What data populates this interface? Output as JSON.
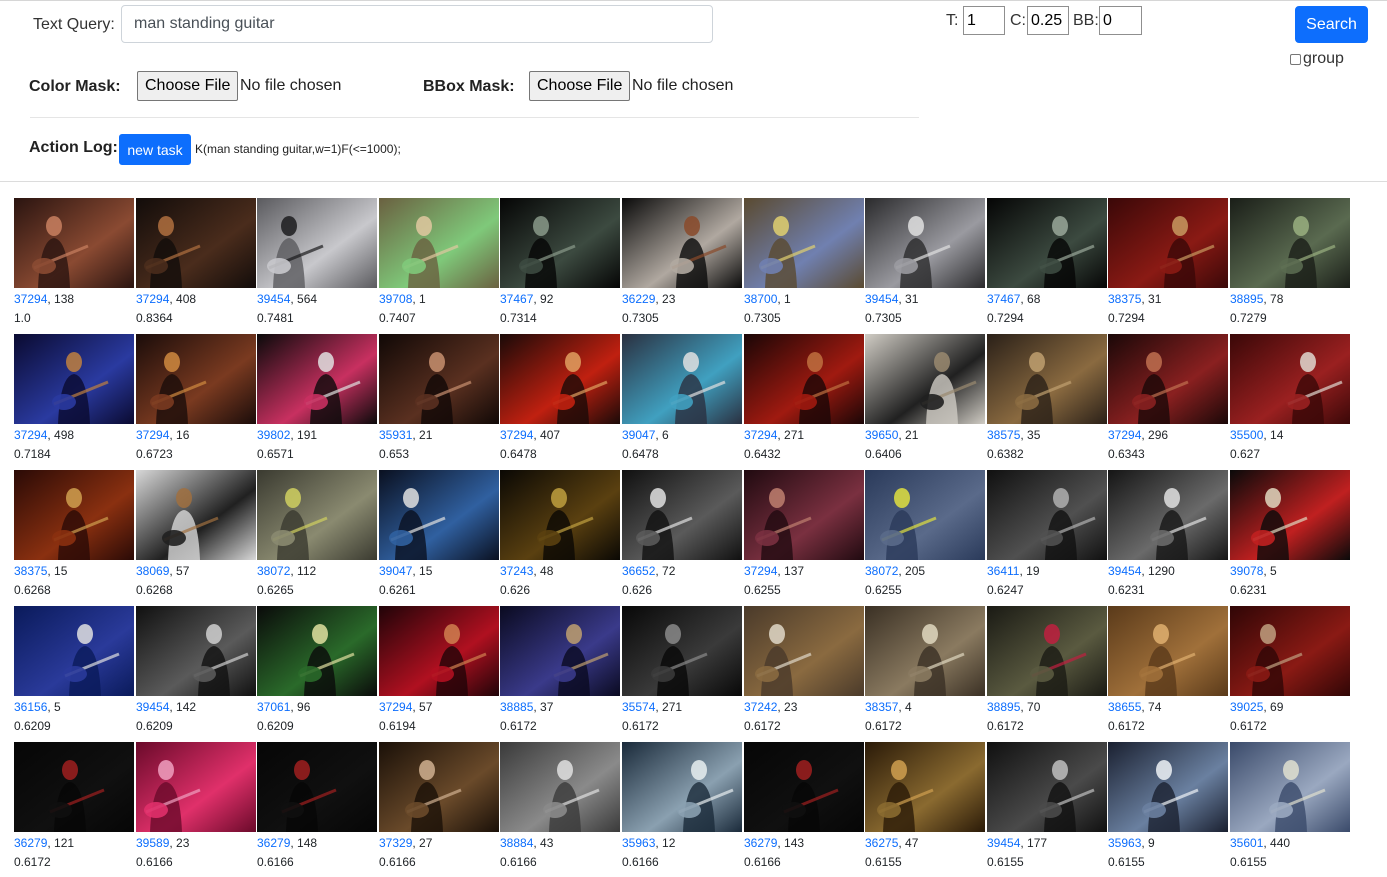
{
  "query": {
    "label": "Text Query:",
    "value": "man standing guitar"
  },
  "params": [
    {
      "label": "T:",
      "value": "1"
    },
    {
      "label": "C:",
      "value": "0.25"
    },
    {
      "label": "BB:",
      "value": "0"
    }
  ],
  "search_label": "Search",
  "group_label": "group",
  "masks": {
    "color_label": "Color Mask:",
    "bbox_label": "BBox Mask:",
    "choose_file": "Choose File",
    "no_file": "No file chosen"
  },
  "action_log": {
    "label": "Action Log:",
    "button": "new task",
    "text": "K(man standing guitar,w=1)F(<=1000);"
  },
  "colors": {
    "accent": "#0d6efd",
    "link": "#0d6efd"
  },
  "results": [
    {
      "video": "37294",
      "frame": "138",
      "score": "1.0",
      "palette": [
        "#2a1410",
        "#8a4a32",
        "#c98060"
      ]
    },
    {
      "video": "37294",
      "frame": "408",
      "score": "0.8364",
      "palette": [
        "#120c0a",
        "#4a2c1c",
        "#b07040"
      ]
    },
    {
      "video": "39454",
      "frame": "564",
      "score": "0.7481",
      "palette": [
        "#5a5a5e",
        "#c8c8cc",
        "#1c1c1e"
      ]
    },
    {
      "video": "39708",
      "frame": "1",
      "score": "0.7407",
      "palette": [
        "#6a6040",
        "#7fc97a",
        "#e0c8a0"
      ]
    },
    {
      "video": "37467",
      "frame": "92",
      "score": "0.7314",
      "palette": [
        "#050505",
        "#3c4a40",
        "#8a9a8a"
      ]
    },
    {
      "video": "36229",
      "frame": "23",
      "score": "0.7305",
      "palette": [
        "#0a0a0a",
        "#b0a8a0",
        "#8a4a2a"
      ]
    },
    {
      "video": "38700",
      "frame": "1",
      "score": "0.7305",
      "palette": [
        "#5a4a30",
        "#7080b0",
        "#e0d070"
      ]
    },
    {
      "video": "39454",
      "frame": "31",
      "score": "0.7305",
      "palette": [
        "#2a2a2c",
        "#9a9aa0",
        "#e0e0e0"
      ]
    },
    {
      "video": "37467",
      "frame": "68",
      "score": "0.7294",
      "palette": [
        "#050505",
        "#3c4a40",
        "#9aa89a"
      ]
    },
    {
      "video": "38375",
      "frame": "31",
      "score": "0.7294",
      "palette": [
        "#3a0808",
        "#8a1a14",
        "#c89a60"
      ]
    },
    {
      "video": "38895",
      "frame": "78",
      "score": "0.7279",
      "palette": [
        "#1a1e18",
        "#5a6a50",
        "#9ab080"
      ]
    },
    {
      "video": "37294",
      "frame": "498",
      "score": "0.7184",
      "palette": [
        "#0a0a30",
        "#2a3aa0",
        "#c08040"
      ]
    },
    {
      "video": "37294",
      "frame": "16",
      "score": "0.6723",
      "palette": [
        "#1a0c0a",
        "#7a3a20",
        "#d08a40"
      ]
    },
    {
      "video": "39802",
      "frame": "191",
      "score": "0.6571",
      "palette": [
        "#0a0a0a",
        "#c83060",
        "#e0e0e0"
      ]
    },
    {
      "video": "35931",
      "frame": "21",
      "score": "0.653",
      "palette": [
        "#100806",
        "#5a3020",
        "#c89070"
      ]
    },
    {
      "video": "37294",
      "frame": "407",
      "score": "0.6478",
      "palette": [
        "#1a0a08",
        "#c02010",
        "#e0a060"
      ]
    },
    {
      "video": "39047",
      "frame": "6",
      "score": "0.6478",
      "palette": [
        "#2a3040",
        "#40a0c0",
        "#e0e0e0"
      ]
    },
    {
      "video": "37294",
      "frame": "271",
      "score": "0.6432",
      "palette": [
        "#1a0606",
        "#a01a10",
        "#c07040"
      ]
    },
    {
      "video": "39650",
      "frame": "21",
      "score": "0.6406",
      "palette": [
        "#d0ccc4",
        "#202020",
        "#9a8a70"
      ]
    },
    {
      "video": "38575",
      "frame": "35",
      "score": "0.6382",
      "palette": [
        "#2a2018",
        "#8a6a40",
        "#c0a070"
      ]
    },
    {
      "video": "37294",
      "frame": "296",
      "score": "0.6343",
      "palette": [
        "#1a0808",
        "#8a2020",
        "#c07050"
      ]
    },
    {
      "video": "35500",
      "frame": "14",
      "score": "0.627",
      "palette": [
        "#3a0808",
        "#9a2020",
        "#e0d8d0"
      ]
    },
    {
      "video": "38375",
      "frame": "15",
      "score": "0.6268",
      "palette": [
        "#2a0a06",
        "#8a3010",
        "#d0a050"
      ]
    },
    {
      "video": "38069",
      "frame": "57",
      "score": "0.6268",
      "palette": [
        "#d8d8d8",
        "#202020",
        "#a07040"
      ]
    },
    {
      "video": "38072",
      "frame": "112",
      "score": "0.6265",
      "palette": [
        "#3a3a30",
        "#8a8a70",
        "#d0d060"
      ]
    },
    {
      "video": "39047",
      "frame": "15",
      "score": "0.6261",
      "palette": [
        "#0a1020",
        "#3060a0",
        "#e0e0e0"
      ]
    },
    {
      "video": "37243",
      "frame": "48",
      "score": "0.626",
      "palette": [
        "#0a0804",
        "#5a4010",
        "#c0a040"
      ]
    },
    {
      "video": "36652",
      "frame": "72",
      "score": "0.626",
      "palette": [
        "#101010",
        "#5a5a5a",
        "#e0e0e0"
      ]
    },
    {
      "video": "37294",
      "frame": "137",
      "score": "0.6255",
      "palette": [
        "#200a10",
        "#7a3040",
        "#c08070"
      ]
    },
    {
      "video": "38072",
      "frame": "205",
      "score": "0.6255",
      "palette": [
        "#2a3a5a",
        "#5a6a8a",
        "#e0e040"
      ]
    },
    {
      "video": "36411",
      "frame": "19",
      "score": "0.6247",
      "palette": [
        "#101010",
        "#505050",
        "#b0b0b0"
      ]
    },
    {
      "video": "39454",
      "frame": "1290",
      "score": "0.6231",
      "palette": [
        "#151515",
        "#6a6a6a",
        "#e0e0e0"
      ]
    },
    {
      "video": "39078",
      "frame": "5",
      "score": "0.6231",
      "palette": [
        "#0a0a0a",
        "#c02020",
        "#e0d8c0"
      ]
    },
    {
      "video": "36156",
      "frame": "5",
      "score": "0.6209",
      "palette": [
        "#0a1a5a",
        "#2a3a9a",
        "#e0e0e0"
      ]
    },
    {
      "video": "39454",
      "frame": "142",
      "score": "0.6209",
      "palette": [
        "#101010",
        "#5a5a5a",
        "#d0d0d0"
      ]
    },
    {
      "video": "37061",
      "frame": "96",
      "score": "0.6209",
      "palette": [
        "#0a0a0a",
        "#2a6a2a",
        "#e0e0a0"
      ]
    },
    {
      "video": "37294",
      "frame": "57",
      "score": "0.6194",
      "palette": [
        "#200408",
        "#b01020",
        "#d08050"
      ]
    },
    {
      "video": "38885",
      "frame": "37",
      "score": "0.6172",
      "palette": [
        "#0a0a20",
        "#3a3a8a",
        "#c0a070"
      ]
    },
    {
      "video": "35574",
      "frame": "271",
      "score": "0.6172",
      "palette": [
        "#080808",
        "#3a3a3a",
        "#8a8a8a"
      ]
    },
    {
      "video": "37242",
      "frame": "23",
      "score": "0.6172",
      "palette": [
        "#4a3a2a",
        "#8a6a40",
        "#e0d8c8"
      ]
    },
    {
      "video": "38357",
      "frame": "4",
      "score": "0.6172",
      "palette": [
        "#3a3024",
        "#8a7a60",
        "#e0d8c0"
      ]
    },
    {
      "video": "38895",
      "frame": "70",
      "score": "0.6172",
      "palette": [
        "#1a1a14",
        "#5a5a40",
        "#c02040"
      ]
    },
    {
      "video": "38655",
      "frame": "74",
      "score": "0.6172",
      "palette": [
        "#5a3a1a",
        "#a0703a",
        "#e0b070"
      ]
    },
    {
      "video": "39025",
      "frame": "69",
      "score": "0.6172",
      "palette": [
        "#300606",
        "#8a1a14",
        "#c0a080"
      ]
    },
    {
      "video": "36279",
      "frame": "121",
      "score": "0.6172",
      "palette": [
        "#060606",
        "#101010",
        "#a02020"
      ]
    },
    {
      "video": "39589",
      "frame": "23",
      "score": "0.6166",
      "palette": [
        "#6a0a2a",
        "#e0306a",
        "#f0a0c0"
      ]
    },
    {
      "video": "36279",
      "frame": "148",
      "score": "0.6166",
      "palette": [
        "#060606",
        "#101010",
        "#a02020"
      ]
    },
    {
      "video": "37329",
      "frame": "27",
      "score": "0.6166",
      "palette": [
        "#1a1008",
        "#6a4a2a",
        "#d0b090"
      ]
    },
    {
      "video": "38884",
      "frame": "43",
      "score": "0.6166",
      "palette": [
        "#3a3a3a",
        "#8a8a8a",
        "#e0e0e0"
      ]
    },
    {
      "video": "35963",
      "frame": "12",
      "score": "0.6166",
      "palette": [
        "#1a2a3a",
        "#8aa0b0",
        "#e8eef0"
      ]
    },
    {
      "video": "36279",
      "frame": "143",
      "score": "0.6166",
      "palette": [
        "#060606",
        "#101010",
        "#a02020"
      ]
    },
    {
      "video": "36275",
      "frame": "47",
      "score": "0.6155",
      "palette": [
        "#2a1a08",
        "#8a6a30",
        "#d0a050"
      ]
    },
    {
      "video": "39454",
      "frame": "177",
      "score": "0.6155",
      "palette": [
        "#101010",
        "#4a4a4a",
        "#c0c0c0"
      ]
    },
    {
      "video": "35963",
      "frame": "9",
      "score": "0.6155",
      "palette": [
        "#1a2030",
        "#6a80a0",
        "#eef2f6"
      ]
    },
    {
      "video": "35601",
      "frame": "440",
      "score": "0.6155",
      "palette": [
        "#3a4a6a",
        "#9aa8c0",
        "#e0e0d0"
      ]
    }
  ]
}
